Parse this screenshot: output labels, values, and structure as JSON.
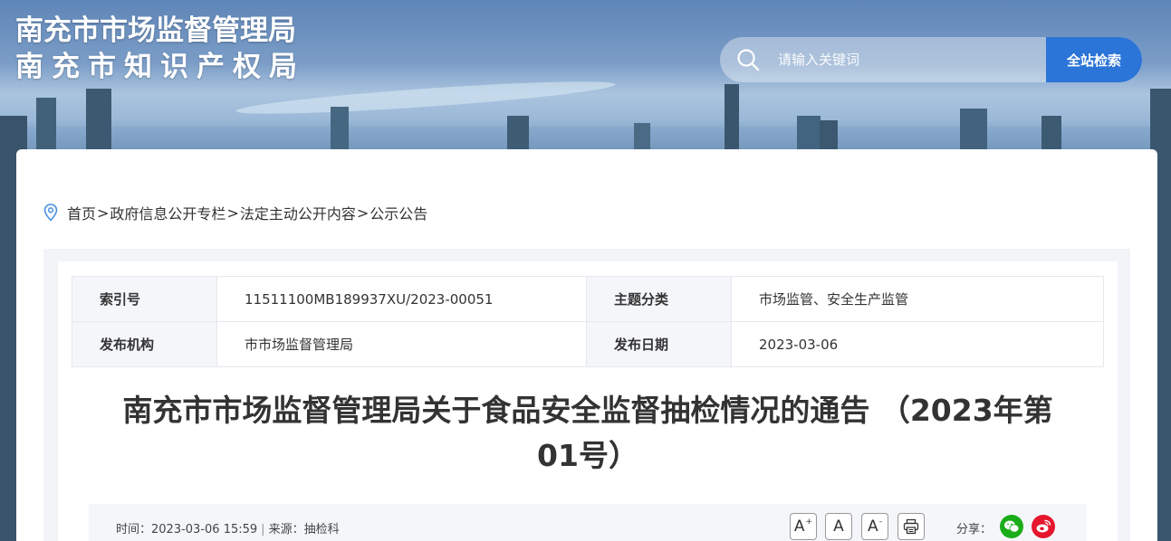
{
  "header": {
    "title_line1": "南充市市场监督管理局",
    "title_line2": "南充市知识产权局"
  },
  "search": {
    "placeholder": "请输入关键词",
    "button_label": "全站检索",
    "icon": "search-icon"
  },
  "breadcrumb": {
    "icon": "location-pin-icon",
    "items": [
      "首页",
      "政府信息公开专栏",
      "法定主动公开内容",
      "公示公告"
    ],
    "separator": ">"
  },
  "meta": {
    "rows": [
      {
        "k1": "索引号",
        "v1": "11511100MB189937XU/2023-00051",
        "k2": "主题分类",
        "v2": "市场监管、安全生产监管"
      },
      {
        "k1": "发布机构",
        "v1": "市市场监督管理局",
        "k2": "发布日期",
        "v2": "2023-03-06"
      }
    ]
  },
  "article": {
    "title": "南充市市场监督管理局关于食品安全监督抽检情况的通告 （2023年第01号）",
    "time_label": "时间：",
    "time": "2023-03-06 15:59",
    "divider": "|",
    "source_label": "来源：",
    "source": "抽检科"
  },
  "tools": {
    "font_larger": "A",
    "font_normal": "A",
    "font_smaller": "A",
    "larger_sup": "+",
    "smaller_sup": "-",
    "print_icon": "printer-icon"
  },
  "share": {
    "label": "分享：",
    "wechat_icon": "wechat-icon",
    "weibo_icon": "weibo-icon"
  },
  "colors": {
    "accent": "#2b74d8",
    "wechat": "#1aad19",
    "weibo": "#e6162d"
  }
}
